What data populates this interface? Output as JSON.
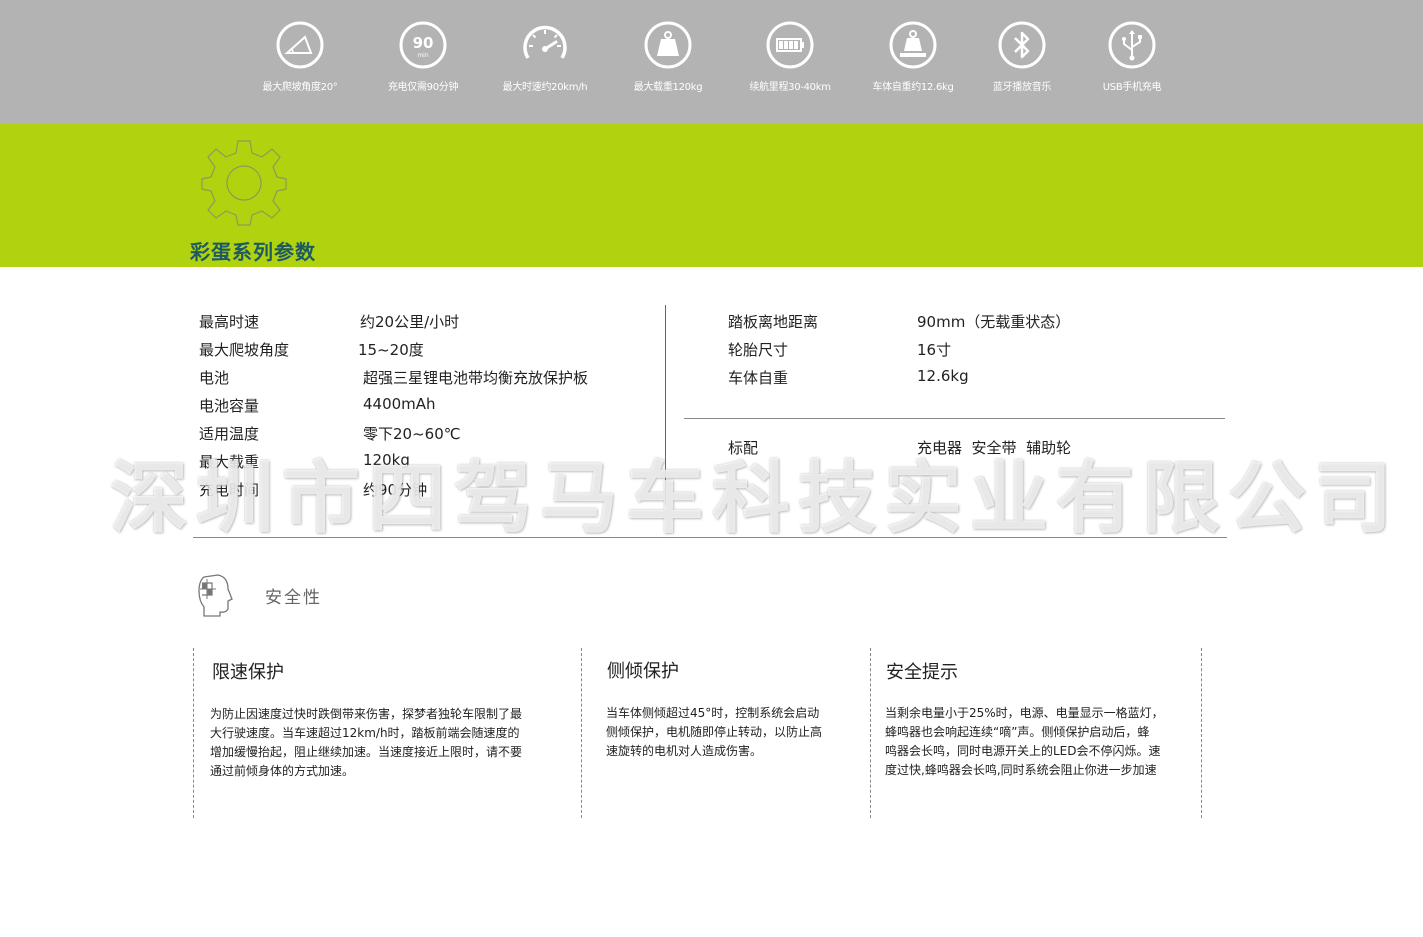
{
  "features": [
    {
      "icon": "slope-icon",
      "label": "最大爬坡角度20°"
    },
    {
      "icon": "timer-icon",
      "label": "充电仅需90分钟",
      "icon_text": "90",
      "icon_sub": "min"
    },
    {
      "icon": "speedometer-icon",
      "label": "最大时速约20km/h"
    },
    {
      "icon": "weight-icon",
      "label": "最大载重120kg"
    },
    {
      "icon": "battery-icon",
      "label": "续航里程30-40km"
    },
    {
      "icon": "scale-weight-icon",
      "label": "车体自重约12.6kg"
    },
    {
      "icon": "bluetooth-icon",
      "label": "蓝牙播放音乐"
    },
    {
      "icon": "usb-icon",
      "label": "USB手机充电"
    }
  ],
  "section_title": "彩蛋系列参数",
  "specs_left": [
    {
      "label": "最高时速",
      "value": "约20公里/小时"
    },
    {
      "label": "最大爬坡角度",
      "value": "15~20度"
    },
    {
      "label": "电池",
      "value": "超强三星锂电池带均衡充放保护板"
    },
    {
      "label": "电池容量",
      "value": "4400mAh"
    },
    {
      "label": "适用温度",
      "value": "零下20~60℃"
    },
    {
      "label": "最大载重",
      "value": "120kg"
    },
    {
      "label": "充电时间",
      "value": "约90分钟"
    }
  ],
  "specs_right": [
    {
      "label": "踏板离地距离",
      "value": "90mm（无载重状态）"
    },
    {
      "label": "轮胎尺寸",
      "value": "16寸"
    },
    {
      "label": "车体自重",
      "value": "12.6kg"
    }
  ],
  "accessories": {
    "label": "标配",
    "value": "充电器  安全带  辅助轮"
  },
  "watermark": "深圳市四驾马车科技实业有限公司",
  "safety": {
    "title": "安全性",
    "columns": [
      {
        "title": "限速保护",
        "lines": [
          "为防止因速度过快时跌倒带来伤害，探梦者独轮车限制了最",
          "大行驶速度。当车速超过12km/h时，踏板前端会随速度的",
          "增加缓慢抬起，阻止继续加速。当速度接近上限时，请不要",
          "通过前倾身体的方式加速。"
        ]
      },
      {
        "title": "侧倾保护",
        "lines": [
          "当车体侧倾超过45°时，控制系统会启动",
          "侧倾保护，电机随即停止转动，以防止高",
          "速旋转的电机对人造成伤害。"
        ]
      },
      {
        "title": "安全提示",
        "lines": [
          "当剩余电量小于25%时，电源、电量显示一格蓝灯，",
          "蜂鸣器也会响起连续“嘀”声。侧倾保护启动后，蜂",
          "鸣器会长鸣，同时电源开关上的LED会不停闪烁。速",
          "度过快,蜂鸣器会长鸣,同时系统会阻止你进一步加速"
        ]
      }
    ]
  }
}
